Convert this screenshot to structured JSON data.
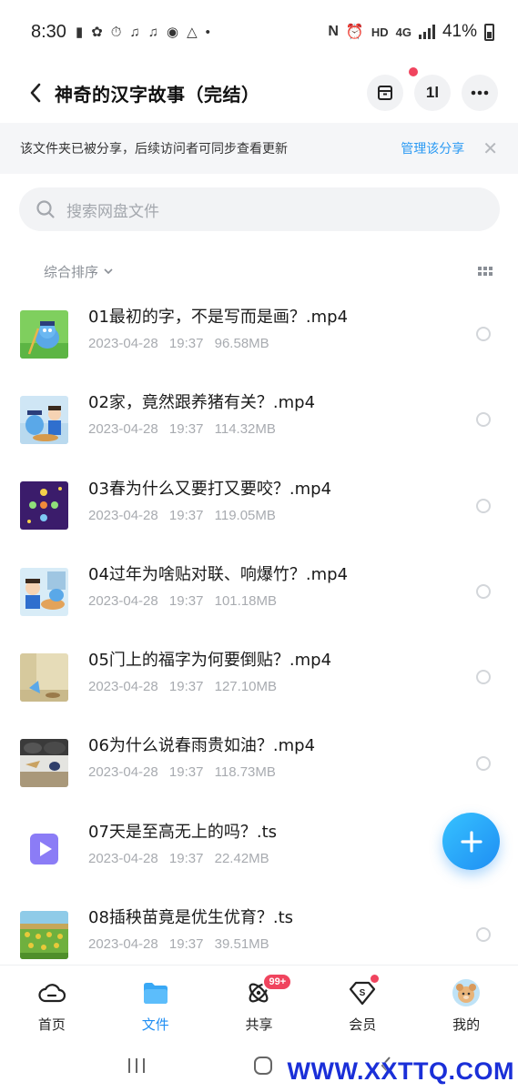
{
  "status_bar": {
    "time": "8:30",
    "battery": "41%",
    "network_hd": "HD",
    "network_lte": "4G"
  },
  "header": {
    "title": "神奇的汉字故事（完结）",
    "sort_button_label": "1l"
  },
  "share_banner": {
    "text": "该文件夹已被分享，后续访问者可同步查看更新",
    "link": "管理该分享"
  },
  "search": {
    "placeholder": "搜索网盘文件"
  },
  "sort": {
    "label": "综合排序"
  },
  "files": [
    {
      "name": "01最初的字，不是写而是画？.mp4",
      "date": "2023-04-28",
      "time": "19:37",
      "size": "96.58MB",
      "thumb": "video-thumb-1"
    },
    {
      "name": "02家，竟然跟养猪有关？.mp4",
      "date": "2023-04-28",
      "time": "19:37",
      "size": "114.32MB",
      "thumb": "video-thumb-2"
    },
    {
      "name": "03春为什么又要打又要咬？.mp4",
      "date": "2023-04-28",
      "time": "19:37",
      "size": "119.05MB",
      "thumb": "video-thumb-3"
    },
    {
      "name": "04过年为啥贴对联、响爆竹？.mp4",
      "date": "2023-04-28",
      "time": "19:37",
      "size": "101.18MB",
      "thumb": "video-thumb-4"
    },
    {
      "name": "05门上的福字为何要倒贴？.mp4",
      "date": "2023-04-28",
      "time": "19:37",
      "size": "127.10MB",
      "thumb": "video-thumb-5"
    },
    {
      "name": "06为什么说春雨贵如油？.mp4",
      "date": "2023-04-28",
      "time": "19:37",
      "size": "118.73MB",
      "thumb": "video-thumb-6"
    },
    {
      "name": "07天是至高无上的吗？.ts",
      "date": "2023-04-28",
      "time": "19:37",
      "size": "22.42MB",
      "thumb": "video-file-icon"
    },
    {
      "name": "08插秧苗竟是优生优育？.ts",
      "date": "2023-04-28",
      "time": "19:37",
      "size": "39.51MB",
      "thumb": "video-thumb-8"
    }
  ],
  "bottom_nav": {
    "items": [
      {
        "label": "首页",
        "icon": "cloud-icon"
      },
      {
        "label": "文件",
        "icon": "folder-icon"
      },
      {
        "label": "共享",
        "icon": "atom-icon",
        "badge": "99+"
      },
      {
        "label": "会员",
        "icon": "diamond-icon"
      },
      {
        "label": "我的",
        "icon": "avatar-icon"
      }
    ]
  },
  "watermark": "WWW.XXTTQ.COM",
  "colors": {
    "accent": "#1f8ef3",
    "badge": "#f0445e",
    "link": "#2b9af3"
  }
}
